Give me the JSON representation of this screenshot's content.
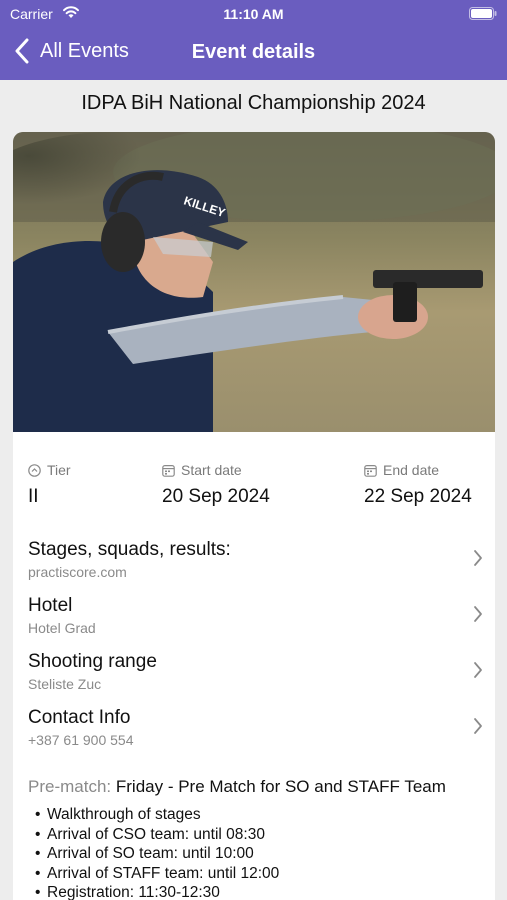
{
  "status": {
    "carrier": "Carrier",
    "time": "11:10 AM"
  },
  "nav": {
    "back_label": "All Events",
    "title": "Event details"
  },
  "event": {
    "title": "IDPA BiH National Championship 2024",
    "tier_label": "Tier",
    "tier_value": "II",
    "start_label": "Start date",
    "start_value": "20 Sep 2024",
    "end_label": "End date",
    "end_value": "22 Sep 2024"
  },
  "rows": [
    {
      "title": "Stages, squads, results:",
      "subtitle": "practiscore.com"
    },
    {
      "title": "Hotel",
      "subtitle": "Hotel Grad"
    },
    {
      "title": "Shooting range",
      "subtitle": "Steliste Zuc"
    },
    {
      "title": "Contact Info",
      "subtitle": "+387 61 900 554"
    }
  ],
  "prematch": {
    "label": "Pre-match:",
    "value": "Friday - Pre Match for SO and STAFF Team",
    "items": [
      "Walkthrough of stages",
      "Arrival of CSO team: until 08:30",
      "Arrival of SO team: until 10:00",
      "Arrival of STAFF team: until 12:00",
      "Registration: 11:30-12:30"
    ]
  },
  "colors": {
    "nav_bar": "#6a5dbf",
    "background": "#ededed",
    "secondary_text": "#8a8a8a"
  },
  "icons": {
    "back": "chevron-left-icon",
    "tier": "tier-circle-icon",
    "date": "calendar-icon",
    "row": "chevron-right-icon"
  }
}
